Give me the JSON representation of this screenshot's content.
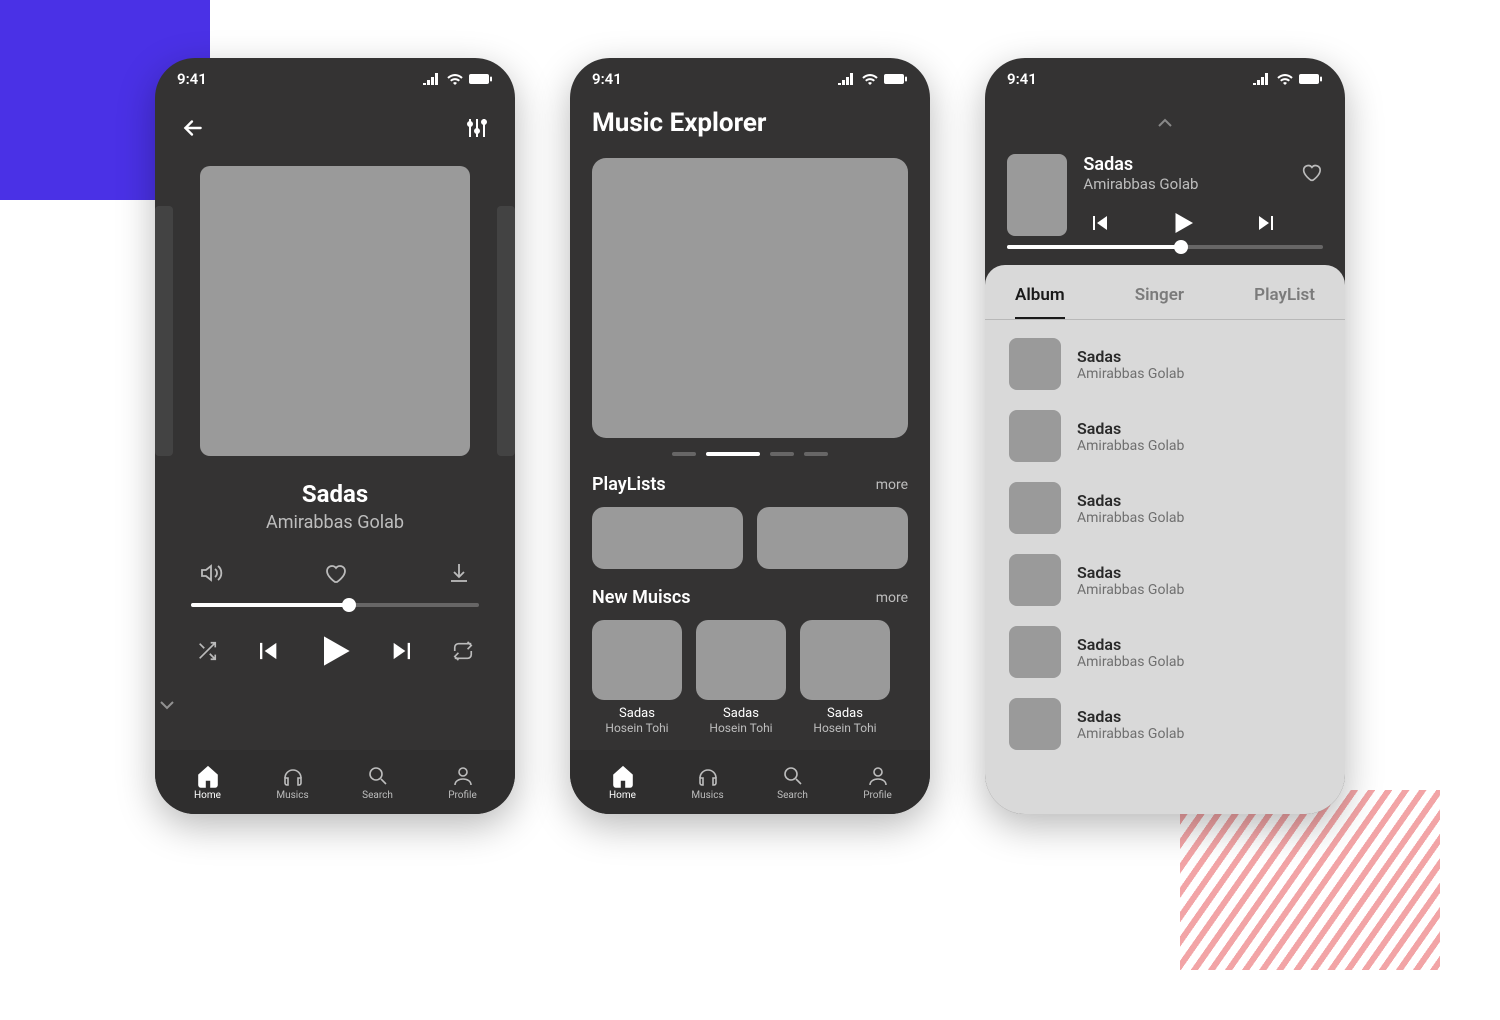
{
  "status": {
    "time": "9:41"
  },
  "tabbar": {
    "items": [
      {
        "label": "Home",
        "icon": "home"
      },
      {
        "label": "Musics",
        "icon": "headphones"
      },
      {
        "label": "Search",
        "icon": "search"
      },
      {
        "label": "Profile",
        "icon": "profile"
      }
    ],
    "active_index": 0
  },
  "screen1": {
    "track": {
      "title": "Sadas",
      "artist": "Amirabbas Golab"
    },
    "progress_pct": 55
  },
  "screen2": {
    "title": "Music Explorer",
    "sections": {
      "playlists": {
        "title": "PlayLists",
        "more": "more"
      },
      "newmusics": {
        "title": "New Muiscs",
        "more": "more"
      }
    },
    "newmusics_items": [
      {
        "title": "Sadas",
        "artist": "Hosein Tohi"
      },
      {
        "title": "Sadas",
        "artist": "Hosein Tohi"
      },
      {
        "title": "Sadas",
        "artist": "Hosein Tohi"
      }
    ]
  },
  "screen3": {
    "now_playing": {
      "title": "Sadas",
      "artist": "Amirabbas Golab"
    },
    "progress_pct": 55,
    "tabs": [
      "Album",
      "Singer",
      "PlayList"
    ],
    "active_tab": 0,
    "albums": [
      {
        "title": "Sadas",
        "artist": "Amirabbas Golab"
      },
      {
        "title": "Sadas",
        "artist": "Amirabbas Golab"
      },
      {
        "title": "Sadas",
        "artist": "Amirabbas Golab"
      },
      {
        "title": "Sadas",
        "artist": "Amirabbas Golab"
      },
      {
        "title": "Sadas",
        "artist": "Amirabbas Golab"
      },
      {
        "title": "Sadas",
        "artist": "Amirabbas Golab"
      }
    ]
  }
}
